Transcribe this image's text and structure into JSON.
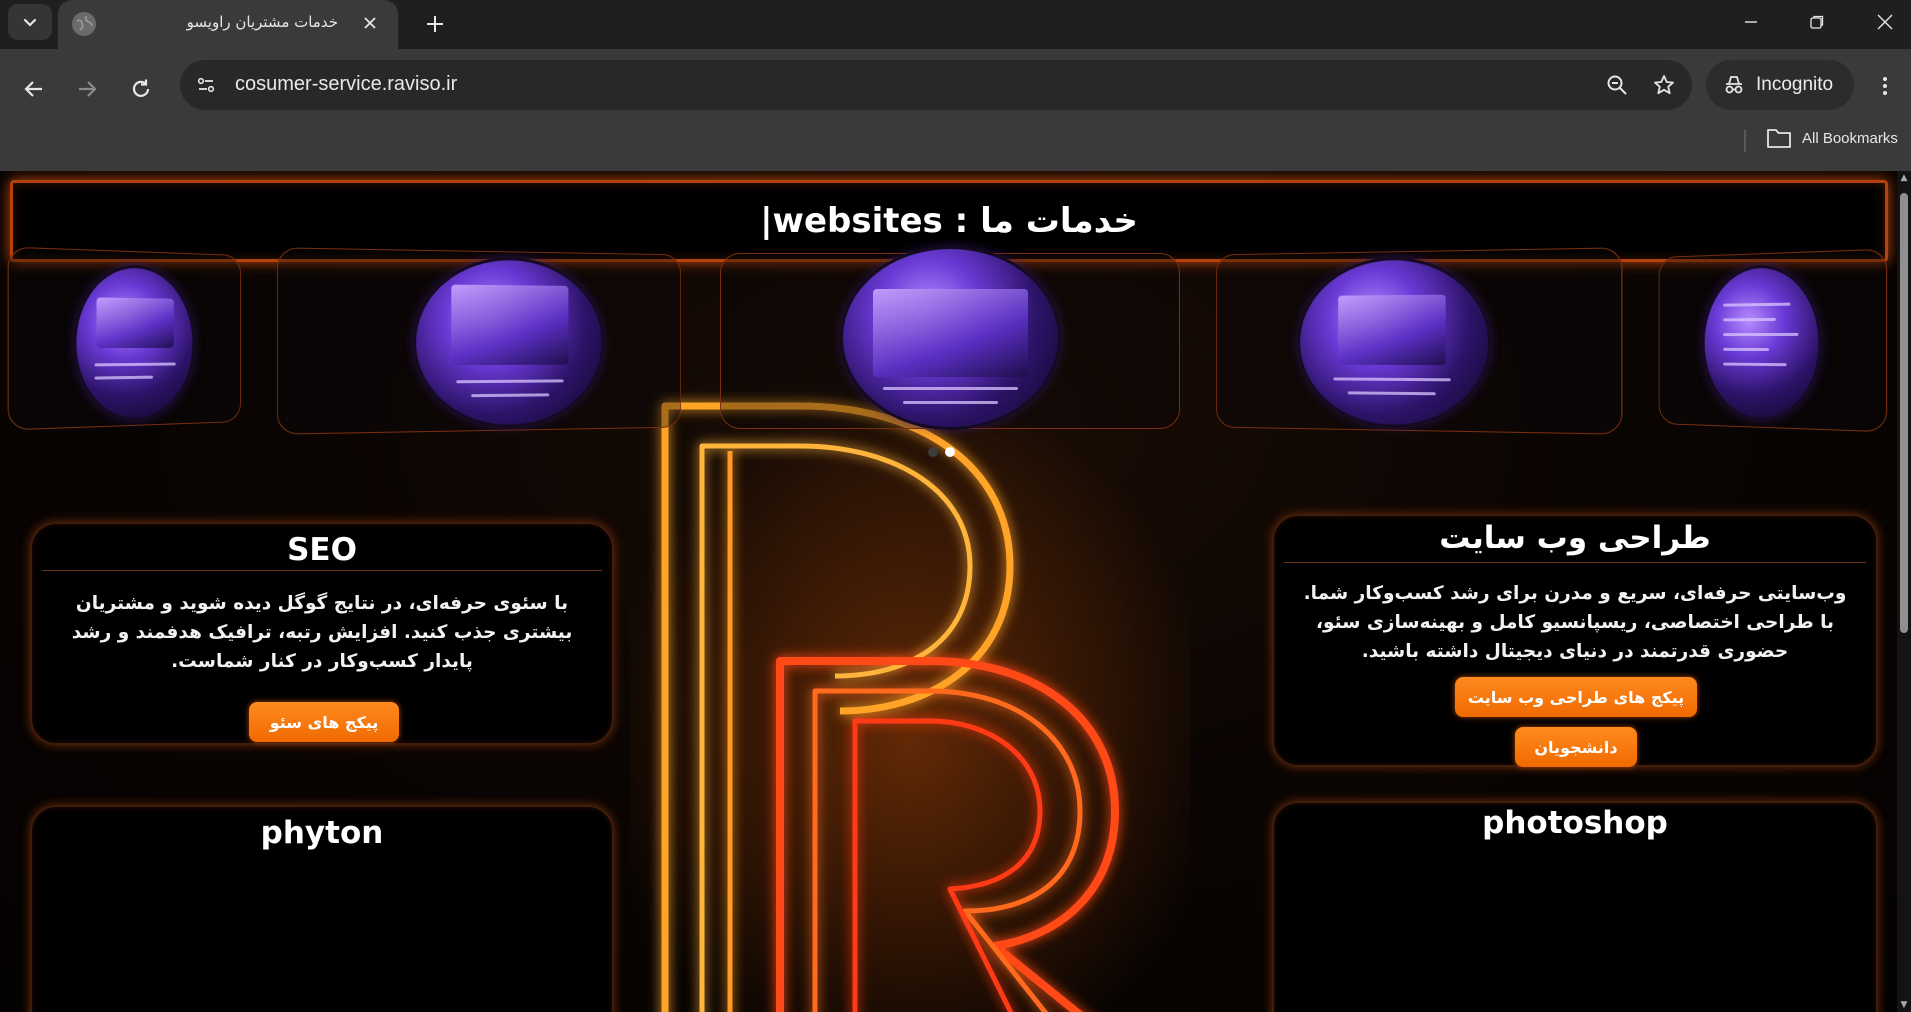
{
  "browser": {
    "tab_title": "خدمات مشتریان راویسو",
    "url": "cosumer-service.raviso.ir",
    "profile_label": "Incognito",
    "bookmarks_label": "All Bookmarks",
    "icons": [
      "tab-search-icon",
      "globe-icon",
      "close-icon",
      "plus-icon",
      "minimize-icon",
      "restore-icon",
      "back-icon",
      "forward-icon",
      "reload-icon",
      "site-info-icon",
      "zoom-icon",
      "star-icon",
      "incognito-icon",
      "more-icon",
      "folder-icon"
    ]
  },
  "page": {
    "header": {
      "title": "خدمات ما : websites",
      "cursor": "|"
    },
    "carousel": {
      "slides": [
        {
          "name": "slide-video-editing",
          "theme": "video editing"
        },
        {
          "name": "slide-photo-editing",
          "theme": "photo editing"
        },
        {
          "name": "slide-web-design",
          "theme": "web design"
        },
        {
          "name": "slide-seo",
          "theme": "seo"
        },
        {
          "name": "slide-python",
          "theme": "code"
        }
      ],
      "active_index": 1,
      "dot_count": 2
    },
    "cards": {
      "seo": {
        "title": "SEO",
        "description": "با سئوی حرفه‌ای، در نتایج گوگل دیده شوید و مشتریان بیشتری جذب کنید. افزایش رتبه، ترافیک هدفمند و رشد پایدار کسب‌وکار در کنار شماست.",
        "button": "پیکج های سئو"
      },
      "web_design": {
        "title": "طراحی وب سایت",
        "description": "وب‌سایتی حرفه‌ای، سریع و مدرن برای رشد کسب‌وکار شما. با طراحی اختصاصی، ریسپانسیو کامل و بهینه‌سازی سئو، حضوری قدرتمند در دنیای دیجیتال داشته باشید.",
        "button_primary": "پیکج های طراحی وب سایت",
        "button_secondary": "دانشجویان"
      },
      "python": {
        "title": "phyton"
      },
      "photoshop": {
        "title": "photoshop"
      }
    },
    "colors": {
      "accent": "#ff7a10",
      "neon_orange": "#ff8a1f",
      "neon_red": "#ff3a12",
      "border": "#b3420c",
      "background": "#050302"
    }
  }
}
